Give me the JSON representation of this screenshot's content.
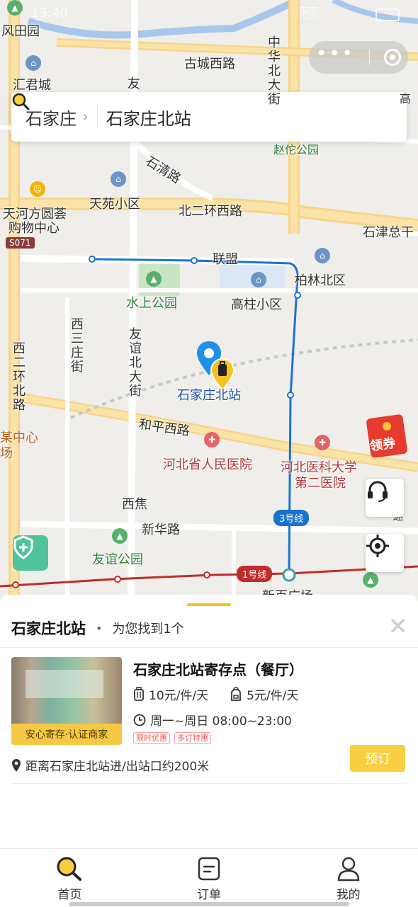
{
  "status_bar": {
    "time": "13:40",
    "network_badge": "HD"
  },
  "capsule": {
    "menu_glyph": "•••"
  },
  "search": {
    "city": "石家庄",
    "query": "石家庄北站"
  },
  "map": {
    "labels": {
      "fengtianyuan": "风田园",
      "huijuncheng": "汇君城",
      "guchengxilu": "古城西路",
      "zhonghuabeidajie": "中华北大街",
      "zhaofogongyuan": "赵佗公园",
      "shiqinglu": "石清路",
      "tianyuanxiaoqu": "天苑小区",
      "tianhe1": "天河方圆荟",
      "tianhe2": "购物中心",
      "beierhuanxilu": "北二环西路",
      "shijinzonggan": "石津总干",
      "lianmeng": "联盟",
      "bailinbeiqu": "柏林北区",
      "shuishanggongyuan": "水上公园",
      "gaozhuxiaoqu": "高柱小区",
      "xisanzhuangjie": "西三庄街",
      "youyibeidajie": "友谊北大街",
      "xierhuanbeilu": "西二环北路",
      "station": "石家庄北站",
      "hepingxilu": "和平西路",
      "hospital1": "河北省人民医院",
      "hospital2a": "河北医科大学",
      "hospital2b": "第二医院",
      "xijiao": "西焦",
      "xinhualu": "新华路",
      "youyigongyuan": "友谊公园",
      "xinbaiguangchang": "新百广场",
      "shijiazhongxin1": "某中心",
      "shijiazhongxin2": "场",
      "you": "友",
      "qiao": "高",
      "su": "速"
    },
    "road_badge": "S071",
    "line3": "3号线",
    "line1": "1号线",
    "coupon": "领券"
  },
  "result": {
    "title": "石家庄北站",
    "found_text": "为您找到1个",
    "store": {
      "name": "石家庄北站寄存点（餐厅）",
      "cert": "安心寄存·认证商家",
      "price_large": "10元/件/天",
      "price_small": "5元/件/天",
      "hours": "周一~周日 08:00~23:00",
      "tags": [
        "限时优惠",
        "多订特惠"
      ],
      "distance": "距离石家庄北站进/出站口约200米",
      "book_label": "预订"
    }
  },
  "tabs": [
    {
      "label": "首页",
      "icon": "search-icon"
    },
    {
      "label": "订单",
      "icon": "order-icon"
    },
    {
      "label": "我的",
      "icon": "profile-icon"
    }
  ]
}
